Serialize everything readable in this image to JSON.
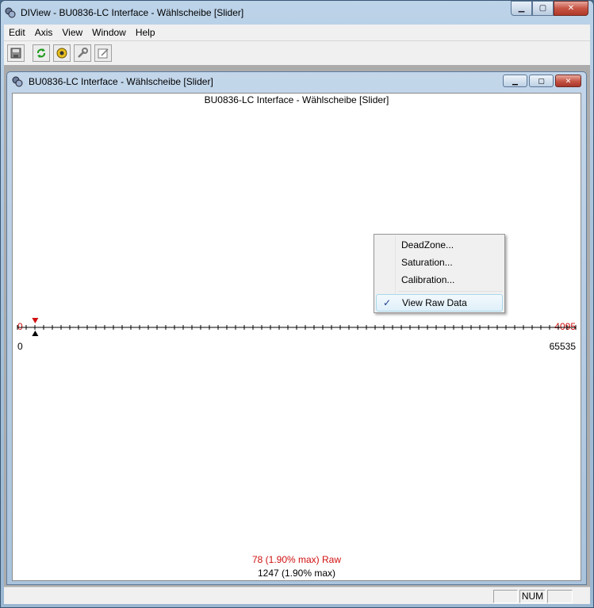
{
  "app": {
    "title": "DIView - BU0836-LC Interface - Wählscheibe [Slider]"
  },
  "menu": [
    "Edit",
    "Axis",
    "View",
    "Window",
    "Help"
  ],
  "toolbar": {
    "icons": [
      "save-icon",
      "refresh-icon",
      "gear-icon",
      "wrench-icon",
      "properties-icon"
    ]
  },
  "child": {
    "title": "BU0836-LC Interface - Wählscheibe [Slider]"
  },
  "plot": {
    "title": "BU0836-LC Interface - Wählscheibe [Slider]",
    "raw_min": "0",
    "raw_max": "4095",
    "val_min": "0",
    "val_max": "65535",
    "raw_readout": "78 (1.90% max)  Raw",
    "val_readout": "1247 (1.90% max)",
    "position_fraction": 0.019,
    "colors": {
      "raw": "#d01010",
      "value": "#000000"
    }
  },
  "context_menu": {
    "items": [
      {
        "label": "DeadZone...",
        "checked": false
      },
      {
        "label": "Saturation...",
        "checked": false
      },
      {
        "label": "Calibration...",
        "checked": false
      },
      {
        "label": "View Raw Data",
        "checked": true
      }
    ]
  },
  "statusbar": {
    "num": "NUM"
  }
}
